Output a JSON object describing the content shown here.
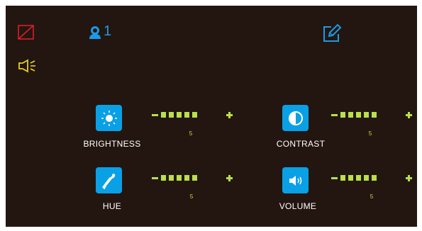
{
  "status_bar": {
    "user_count": "1",
    "colors": {
      "no_signal": "#d81e2a",
      "user": "#1a9ae8",
      "edit": "#1a9ae8",
      "speaker": "#e8d21a"
    },
    "icons": [
      "no-signal-icon",
      "user-icon",
      "speaker-icon",
      "edit-icon"
    ]
  },
  "controls": {
    "brightness": {
      "label": "BRIGHTNESS",
      "value": "5",
      "level": 5,
      "icon": "sun-icon"
    },
    "contrast": {
      "label": "CONTRAST",
      "value": "5",
      "level": 5,
      "icon": "contrast-icon"
    },
    "hue": {
      "label": "HUE",
      "value": "5",
      "level": 5,
      "icon": "dropper-icon"
    },
    "volume": {
      "label": "VOLUME",
      "value": "5",
      "level": 5,
      "icon": "volume-icon"
    }
  },
  "colors": {
    "background": "#231610",
    "button": "#0aa0e6",
    "level": "#b8e04a",
    "text": "#ffffff"
  }
}
